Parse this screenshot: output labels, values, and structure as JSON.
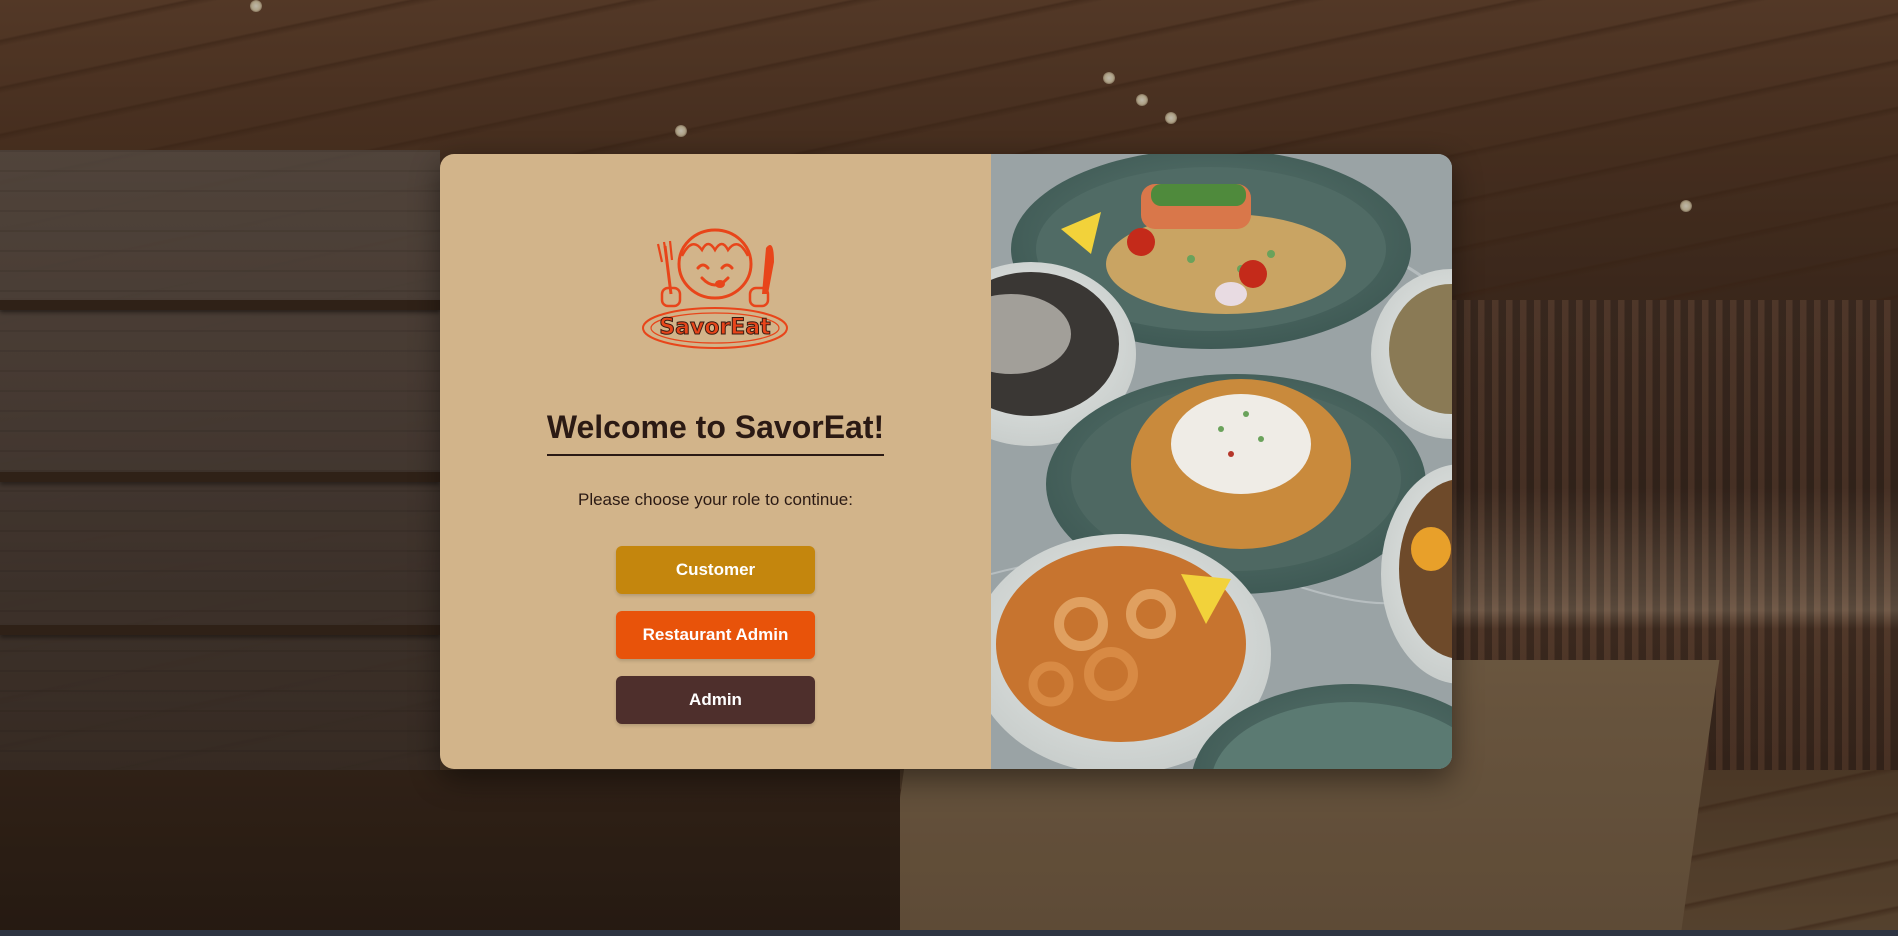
{
  "app": {
    "brand": "SavorEat",
    "colors": {
      "panel_bg": "#d2b48a",
      "text_dark": "#2b1a14",
      "logo_orange": "#e8451a"
    }
  },
  "welcome": {
    "title": "Welcome to SavorEat!",
    "subtitle": "Please choose your role to continue:"
  },
  "roles": {
    "customer": {
      "label": "Customer",
      "color": "#c4860d"
    },
    "restaurant_admin": {
      "label": "Restaurant Admin",
      "color": "#e8530a"
    },
    "admin": {
      "label": "Admin",
      "color": "#4e2f2c"
    }
  },
  "logo": {
    "wordmark": "SavorEat",
    "icon": "smiling-girl-with-fork-and-knife-icon"
  },
  "hero_image": {
    "icon": "food-platter-photo"
  }
}
